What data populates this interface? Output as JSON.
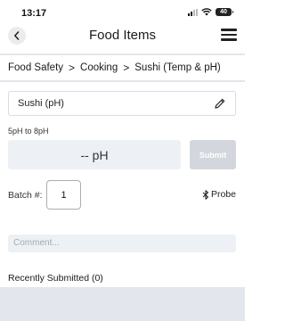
{
  "status_bar": {
    "time": "13:17",
    "battery": "40"
  },
  "header": {
    "title": "Food Items",
    "back_icon": "chevron-left-icon",
    "menu_icon": "hamburger-menu-icon"
  },
  "breadcrumb": {
    "items": [
      "Food Safety",
      "Cooking",
      "Sushi (Temp & pH)"
    ],
    "separator": ">"
  },
  "item_selector": {
    "label": "Sushi (pH)",
    "icon": "pencil-icon"
  },
  "reading": {
    "range": "5pH to 8pH",
    "placeholder": "-- pH",
    "submit_label": "Submit"
  },
  "batch": {
    "label": "Batch #:",
    "value": "1"
  },
  "probe": {
    "label": "Probe",
    "icon": "bluetooth-icon"
  },
  "comment": {
    "placeholder": "Comment..."
  },
  "recent": {
    "label": "Recently Submitted (0)"
  },
  "colors": {
    "input_bg": "#edf0f4",
    "disabled_button": "#d3d6dc",
    "divider": "#e3e6ec"
  }
}
